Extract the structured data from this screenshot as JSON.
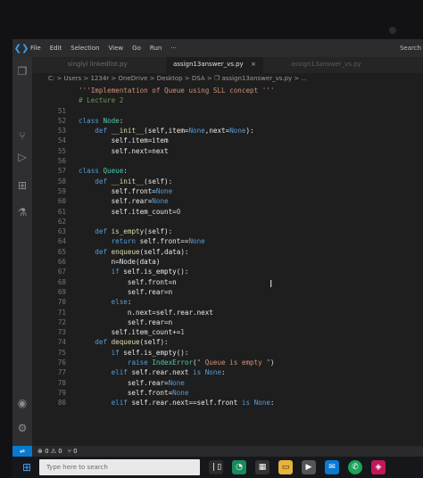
{
  "menu": {
    "items": [
      "File",
      "Edit",
      "Selection",
      "View",
      "Go",
      "Run",
      "···"
    ],
    "search_label": "Search"
  },
  "tabs": {
    "inactive_left": "singlyl linkedlist.py",
    "active_label": "assign13answer_vs.py",
    "close_glyph": "×",
    "inactive_right": "assign13answer_vs.py"
  },
  "breadcrumb": "C: > Users > 1234r > OneDrive > Desktop > DSA > ❐ assign13answer_vs.py > ...",
  "code_lines": [
    {
      "n": "",
      "parts": [
        [
          "str",
          "'''Implementation of Queue using SLL concept '''"
        ]
      ]
    },
    {
      "n": "",
      "parts": [
        [
          "cmt",
          "# Lecture 2"
        ]
      ]
    },
    {
      "n": "51",
      "parts": []
    },
    {
      "n": "52",
      "parts": [
        [
          "kw",
          "class "
        ],
        [
          "cls",
          "Node"
        ],
        [
          "txt",
          ":"
        ]
      ]
    },
    {
      "n": "53",
      "parts": [
        [
          "txt",
          "    "
        ],
        [
          "kw",
          "def "
        ],
        [
          "fn",
          "__init__"
        ],
        [
          "txt",
          "(self,item="
        ],
        [
          "const",
          "None"
        ],
        [
          "txt",
          ",next="
        ],
        [
          "const",
          "None"
        ],
        [
          "txt",
          "):"
        ]
      ]
    },
    {
      "n": "54",
      "parts": [
        [
          "txt",
          "        self.item=item"
        ]
      ]
    },
    {
      "n": "55",
      "parts": [
        [
          "txt",
          "        self.next=next"
        ]
      ]
    },
    {
      "n": "56",
      "parts": []
    },
    {
      "n": "57",
      "parts": [
        [
          "kw",
          "class "
        ],
        [
          "cls",
          "Queue"
        ],
        [
          "txt",
          ":"
        ]
      ]
    },
    {
      "n": "58",
      "parts": [
        [
          "txt",
          "    "
        ],
        [
          "kw",
          "def "
        ],
        [
          "fn",
          "__init__"
        ],
        [
          "txt",
          "(self):"
        ]
      ]
    },
    {
      "n": "59",
      "parts": [
        [
          "txt",
          "        self.front="
        ],
        [
          "const",
          "None"
        ]
      ]
    },
    {
      "n": "60",
      "parts": [
        [
          "txt",
          "        self.rear="
        ],
        [
          "const",
          "None"
        ]
      ]
    },
    {
      "n": "61",
      "parts": [
        [
          "txt",
          "        self.item_count="
        ],
        [
          "num",
          "0"
        ]
      ]
    },
    {
      "n": "62",
      "parts": []
    },
    {
      "n": "63",
      "parts": [
        [
          "txt",
          "    "
        ],
        [
          "kw",
          "def "
        ],
        [
          "fn",
          "is_empty"
        ],
        [
          "txt",
          "(self):"
        ]
      ]
    },
    {
      "n": "64",
      "parts": [
        [
          "txt",
          "        "
        ],
        [
          "kw",
          "return "
        ],
        [
          "txt",
          "self.front=="
        ],
        [
          "const",
          "None"
        ]
      ]
    },
    {
      "n": "65",
      "parts": [
        [
          "txt",
          "    "
        ],
        [
          "kw",
          "def "
        ],
        [
          "fn",
          "enqueue"
        ],
        [
          "txt",
          "(self,data):"
        ]
      ]
    },
    {
      "n": "66",
      "parts": [
        [
          "txt",
          "        n=Node(data)"
        ]
      ]
    },
    {
      "n": "67",
      "parts": [
        [
          "txt",
          "        "
        ],
        [
          "kw",
          "if "
        ],
        [
          "txt",
          "self.is_empty():"
        ]
      ]
    },
    {
      "n": "68",
      "parts": [
        [
          "txt",
          "            self.front=n"
        ]
      ]
    },
    {
      "n": "69",
      "parts": [
        [
          "txt",
          "            self.rear=n"
        ]
      ]
    },
    {
      "n": "70",
      "parts": [
        [
          "txt",
          "        "
        ],
        [
          "kw",
          "else"
        ],
        [
          "txt",
          ":"
        ]
      ]
    },
    {
      "n": "71",
      "parts": [
        [
          "txt",
          "            n.next=self.rear.next"
        ]
      ]
    },
    {
      "n": "72",
      "parts": [
        [
          "txt",
          "            self.rear=n"
        ]
      ]
    },
    {
      "n": "73",
      "parts": [
        [
          "txt",
          "        self.item_count+="
        ],
        [
          "num",
          "1"
        ]
      ]
    },
    {
      "n": "74",
      "parts": [
        [
          "txt",
          "    "
        ],
        [
          "kw",
          "def "
        ],
        [
          "fn",
          "dequeue"
        ],
        [
          "txt",
          "(self):"
        ]
      ]
    },
    {
      "n": "75",
      "parts": [
        [
          "txt",
          "        "
        ],
        [
          "kw",
          "if "
        ],
        [
          "txt",
          "self.is_empty():"
        ]
      ]
    },
    {
      "n": "76",
      "parts": [
        [
          "txt",
          "            "
        ],
        [
          "kw",
          "raise "
        ],
        [
          "cls",
          "IndexError"
        ],
        [
          "txt",
          "("
        ],
        [
          "str",
          "\" Queue is empty \""
        ],
        [
          "txt",
          ")"
        ]
      ]
    },
    {
      "n": "77",
      "parts": [
        [
          "txt",
          "        "
        ],
        [
          "kw",
          "elif "
        ],
        [
          "txt",
          "self.rear.next "
        ],
        [
          "kw",
          "is "
        ],
        [
          "const",
          "None"
        ],
        [
          "txt",
          ":"
        ]
      ]
    },
    {
      "n": "78",
      "parts": [
        [
          "txt",
          "            self.rear="
        ],
        [
          "const",
          "None"
        ]
      ]
    },
    {
      "n": "79",
      "parts": [
        [
          "txt",
          "            self.front="
        ],
        [
          "const",
          "None"
        ]
      ]
    },
    {
      "n": "80",
      "parts": [
        [
          "txt",
          "        "
        ],
        [
          "kw",
          "elif "
        ],
        [
          "txt",
          "self.rear.next==self.front "
        ],
        [
          "kw",
          "is "
        ],
        [
          "const",
          "None"
        ],
        [
          "txt",
          ":"
        ]
      ]
    }
  ],
  "status": {
    "remote_glyph": "⇌",
    "problems": "⊗ 0 ⚠ 0",
    "ports": "⑂ 0"
  },
  "taskbar": {
    "search_placeholder": "Type here to search"
  },
  "colors": {
    "accent": "#0a7ad1",
    "keyword": "#569cd6",
    "function": "#dcdcaa",
    "string": "#ce9178"
  }
}
